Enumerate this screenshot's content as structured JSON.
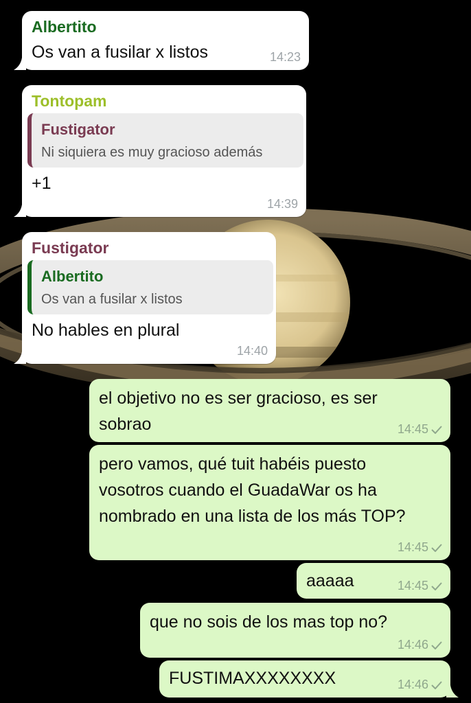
{
  "colors": {
    "incoming_bubble": "#ffffff",
    "outgoing_bubble": "#dcf8c6",
    "sender_albertito": "#1a6b21",
    "sender_tontopam": "#9dbf2a",
    "sender_fustigator": "#7a3b52",
    "timestamp": "#9ea4a8"
  },
  "messages": [
    {
      "sender": "Albertito",
      "text": "Os van a fusilar x listos",
      "time": "14:23"
    },
    {
      "sender": "Tontopam",
      "quote": {
        "name": "Fustigator",
        "text": "Ni siquiera es muy gracioso además"
      },
      "text": "+1",
      "time": "14:39"
    },
    {
      "sender": "Fustigator",
      "quote": {
        "name": "Albertito",
        "text": "Os van a fusilar x listos"
      },
      "text": "No hables en plural",
      "time": "14:40"
    },
    {
      "text": "el objetivo no es ser gracioso, es ser sobrao",
      "time": "14:45",
      "status": "sent-check-icon"
    },
    {
      "text": "pero vamos, qué tuit habéis puesto vosotros cuando el GuadaWar os ha nombrado en una lista de los más TOP?",
      "time": "14:45",
      "status": "sent-check-icon"
    },
    {
      "text": "aaaaa",
      "time": "14:45",
      "status": "sent-check-icon"
    },
    {
      "text": "que no sois de los mas top no?",
      "time": "14:46",
      "status": "sent-check-icon"
    },
    {
      "text": "FUSTIMAXXXXXXXX",
      "time": "14:46",
      "status": "sent-check-icon"
    }
  ]
}
